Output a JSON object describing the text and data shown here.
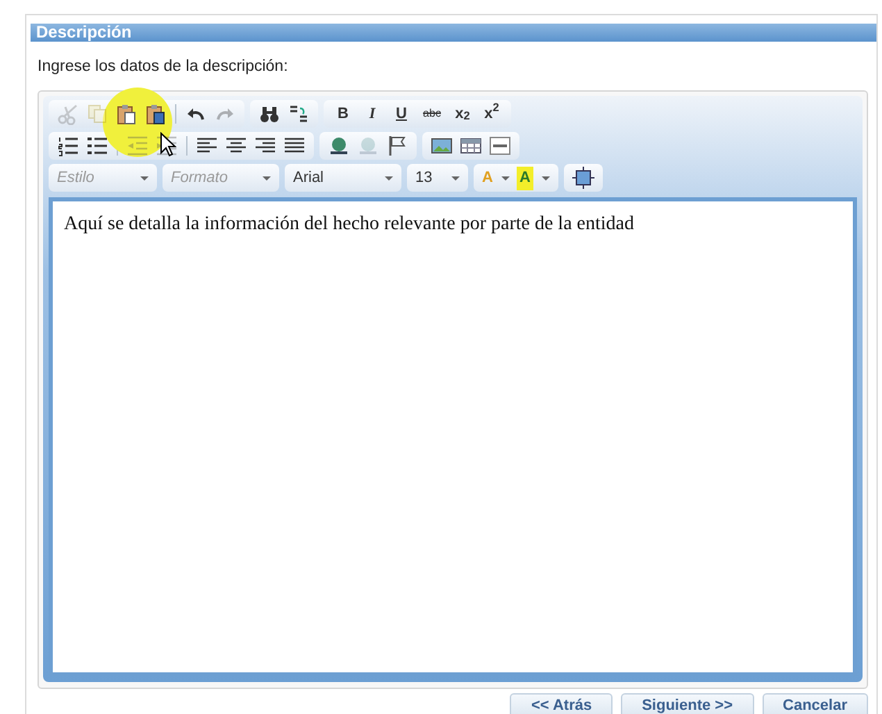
{
  "section": {
    "title": "Descripción",
    "instructions": "Ingrese los datos de la descripción:"
  },
  "toolbar": [
    [
      {
        "items": [
          {
            "kind": "cut",
            "disabled": true
          },
          {
            "kind": "copy",
            "disabled": true
          },
          {
            "kind": "paste",
            "disabled": false
          },
          {
            "kind": "pasteword",
            "disabled": false
          },
          {
            "kind": "sep"
          },
          {
            "kind": "undo",
            "disabled": false
          },
          {
            "kind": "redo",
            "disabled": true
          }
        ]
      },
      {
        "items": [
          {
            "kind": "find",
            "disabled": false
          },
          {
            "kind": "replace",
            "disabled": false
          }
        ]
      },
      {
        "items": [
          {
            "kind": "bold",
            "label": "B"
          },
          {
            "kind": "italic",
            "label": "I"
          },
          {
            "kind": "underline",
            "label": "U"
          },
          {
            "kind": "strike",
            "label": "abc"
          },
          {
            "kind": "subscript",
            "label": "x$_{2}$"
          },
          {
            "kind": "superscript",
            "label": "x$^{2}$"
          }
        ]
      }
    ],
    [
      {
        "items": [
          {
            "kind": "ol",
            "disabled": false
          },
          {
            "kind": "ul",
            "disabled": false
          },
          {
            "kind": "sep"
          },
          {
            "kind": "outdent",
            "disabled": true
          },
          {
            "kind": "indent",
            "disabled": true
          },
          {
            "kind": "sep"
          },
          {
            "kind": "alignleft",
            "disabled": false
          },
          {
            "kind": "aligncenter",
            "disabled": false
          },
          {
            "kind": "alignright",
            "disabled": false
          },
          {
            "kind": "justify",
            "disabled": false
          }
        ]
      },
      {
        "items": [
          {
            "kind": "link",
            "disabled": false
          },
          {
            "kind": "unlink",
            "disabled": true
          },
          {
            "kind": "anchor",
            "disabled": false
          }
        ]
      },
      {
        "items": [
          {
            "kind": "image",
            "disabled": false
          },
          {
            "kind": "table",
            "disabled": false
          },
          {
            "kind": "hr",
            "disabled": false
          }
        ]
      }
    ],
    [
      {
        "items": [
          {
            "kind": "combo",
            "placeholder": "Estilo"
          }
        ]
      },
      {
        "items": [
          {
            "kind": "combo",
            "placeholder": "Formato"
          }
        ]
      },
      {
        "items": [
          {
            "kind": "combo",
            "value": "Arial"
          }
        ]
      },
      {
        "items": [
          {
            "kind": "combo",
            "value": "13"
          }
        ]
      },
      {
        "items": [
          {
            "kind": "textcolor",
            "label": "A"
          },
          {
            "kind": "bgcolor",
            "label": "A"
          }
        ]
      },
      {
        "items": [
          {
            "kind": "maximize",
            "disabled": false
          }
        ]
      }
    ]
  ],
  "cursor": {
    "highlighted": true
  },
  "content": "Aquí se detalla la información del hecho relevante por parte de la entidad",
  "buttons": [
    "<< Atrás",
    "Siguiente >>",
    "Cancelar"
  ]
}
